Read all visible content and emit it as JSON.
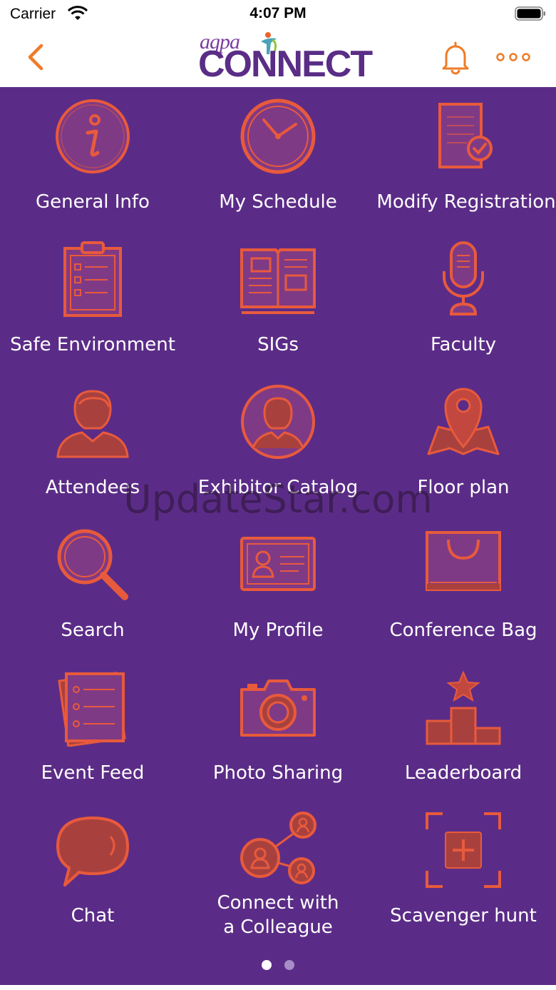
{
  "status_bar": {
    "carrier": "Carrier",
    "time": "4:07 PM"
  },
  "header": {
    "logo_top": "agpa",
    "logo_main": "CONNECT"
  },
  "colors": {
    "accent": "#e85a3c",
    "nav_orange": "#ee7c27",
    "background": "#5b2c87"
  },
  "menu": [
    {
      "label": "General Info",
      "icon": "info-icon"
    },
    {
      "label": "My Schedule",
      "icon": "clock-icon"
    },
    {
      "label": "Modify Registration",
      "icon": "document-check-icon"
    },
    {
      "label": "Safe Environment",
      "icon": "clipboard-checklist-icon"
    },
    {
      "label": "SIGs",
      "icon": "open-book-icon"
    },
    {
      "label": "Faculty",
      "icon": "microphone-icon"
    },
    {
      "label": "Attendees",
      "icon": "person-icon"
    },
    {
      "label": "Exhibitor Catalog",
      "icon": "person-circle-icon"
    },
    {
      "label": "Floor plan",
      "icon": "map-pin-icon"
    },
    {
      "label": "Search",
      "icon": "magnifier-icon"
    },
    {
      "label": "My Profile",
      "icon": "id-card-icon"
    },
    {
      "label": "Conference Bag",
      "icon": "bag-icon"
    },
    {
      "label": "Event Feed",
      "icon": "feed-list-icon"
    },
    {
      "label": "Photo Sharing",
      "icon": "camera-icon"
    },
    {
      "label": "Leaderboard",
      "icon": "podium-star-icon"
    },
    {
      "label": "Chat",
      "icon": "speech-bubble-icon"
    },
    {
      "label_line1": "Connect with",
      "label_line2": "a Colleague",
      "icon": "connect-people-icon"
    },
    {
      "label": "Scavenger hunt",
      "icon": "scan-frame-icon"
    }
  ],
  "pager": {
    "current_page": 1,
    "total_pages": 2
  },
  "watermark": "UpdateStar.com"
}
